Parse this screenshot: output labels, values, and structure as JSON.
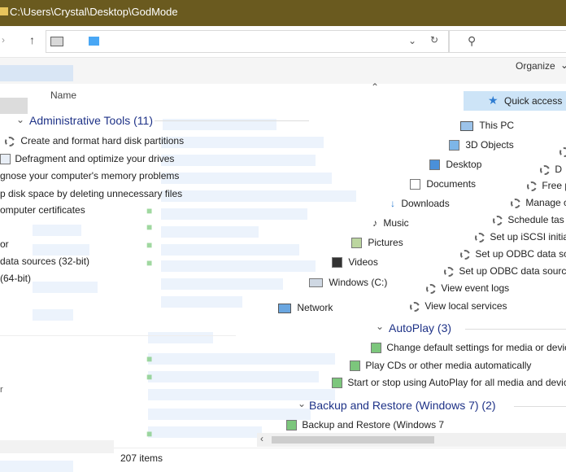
{
  "titlebar": {
    "path": "C:\\Users\\Crystal\\Desktop\\GodMode"
  },
  "toolbar": {
    "organize_label": "Organize"
  },
  "header": {
    "name_column": "Name"
  },
  "left_pane": {
    "group_title": "Administrative Tools (11)",
    "items": [
      "Create and format hard disk partitions",
      "Defragment and optimize your drives",
      "gnose your computer's memory problems",
      "p disk space by deleting unnecessary files",
      "omputer certificates",
      "or",
      "data sources (32-bit)",
      "(64-bit)"
    ]
  },
  "nav_pane": {
    "items": [
      "Quick access",
      "This PC",
      "3D Objects",
      "Desktop",
      "Documents",
      "Downloads",
      "Music",
      "Pictures",
      "Videos",
      "Windows (C:)",
      "Network"
    ]
  },
  "right_items": {
    "items": [
      "D",
      "D",
      "Free p",
      "Manage c",
      "Schedule tas",
      "Set up iSCSI initiat",
      "Set up ODBC data sou",
      "Set up ODBC data sources",
      "View event logs",
      "View local services"
    ],
    "autoplay_group": "AutoPlay (3)",
    "autoplay_items": [
      "Change default settings for media or device",
      "Play CDs or other media automatically",
      "Start or stop using AutoPlay for all media and device"
    ],
    "backup_group": "Backup and Restore (Windows 7) (2)",
    "backup_items": [
      "Backup and Restore (Windows 7"
    ]
  },
  "status": {
    "count": "207 items"
  }
}
